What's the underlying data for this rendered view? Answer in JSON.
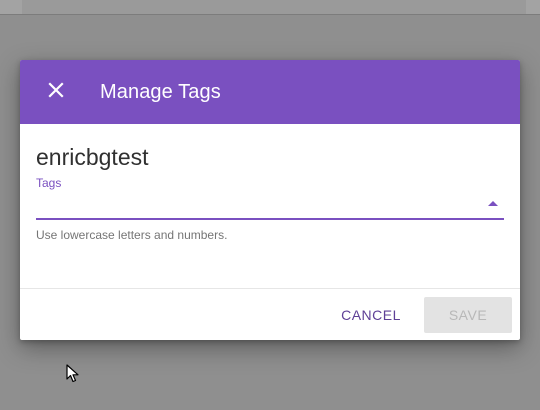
{
  "dialog": {
    "title": "Manage Tags",
    "item_name": "enricbgtest",
    "tags_label": "Tags",
    "tags_value": "",
    "hint": "Use lowercase letters and numbers.",
    "cancel_label": "CANCEL",
    "save_label": "SAVE",
    "save_enabled": false
  },
  "icons": {
    "close": "close-icon",
    "dropdown": "arrow-drop-up-icon",
    "cursor": "mouse-pointer-icon"
  },
  "colors": {
    "accent": "#7a50c0",
    "button_text": "#5e3f96",
    "disabled_bg": "#e3e3e3",
    "disabled_text": "#b8b8b8"
  }
}
